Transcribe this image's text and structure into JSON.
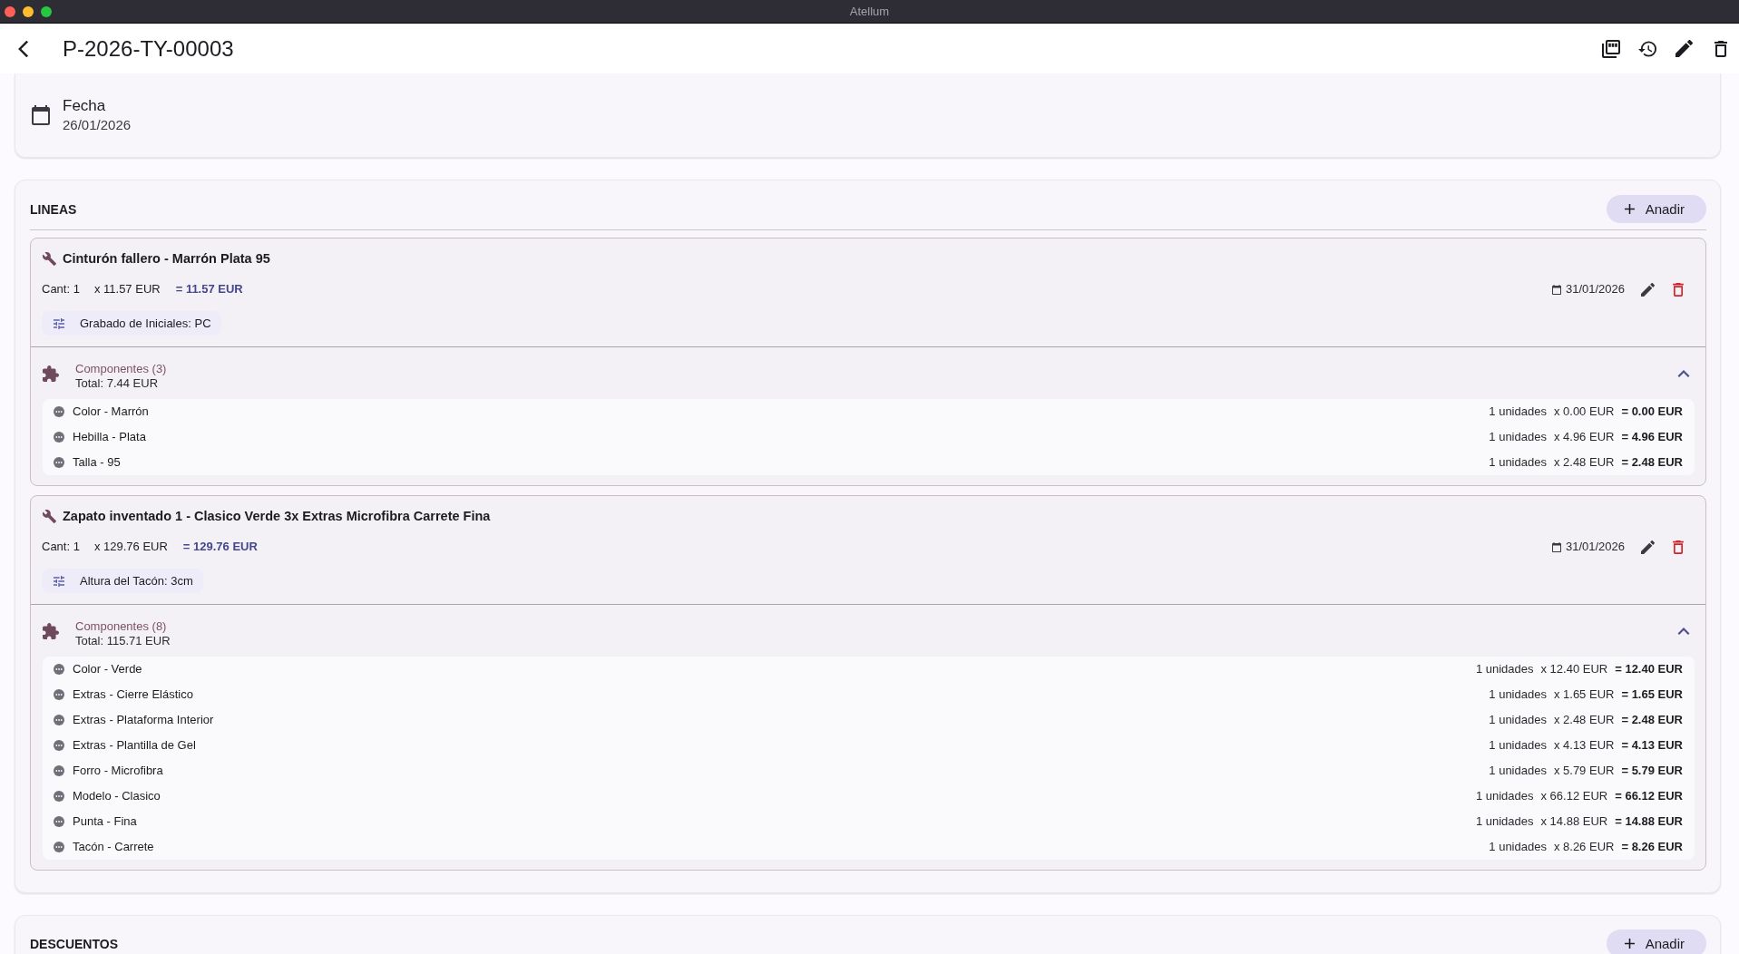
{
  "window": {
    "title": "Atellum"
  },
  "app_bar": {
    "title": "P-2026-TY-00003"
  },
  "date_field": {
    "label": "Fecha",
    "value": "26/01/2026"
  },
  "lines_section": {
    "title": "LINEAS",
    "add_button": "Anadir",
    "lines": [
      {
        "name": "Cinturón fallero - Marrón Plata 95",
        "quantity": "Cant: 1",
        "unit_price": "x 11.57 EUR",
        "total": "= 11.57 EUR",
        "date": "31/01/2026",
        "options": [
          "Grabado de Iniciales: PC"
        ],
        "components": {
          "title": "Componentes (3)",
          "total": "Total: 7.44 EUR",
          "expanded": true,
          "items": [
            {
              "name": "Color - Marrón",
              "quantity": "1 unidades",
              "unit_price": "x 0.00 EUR",
              "total": "= 0.00 EUR"
            },
            {
              "name": "Hebilla - Plata",
              "quantity": "1 unidades",
              "unit_price": "x 4.96 EUR",
              "total": "= 4.96 EUR"
            },
            {
              "name": "Talla - 95",
              "quantity": "1 unidades",
              "unit_price": "x 2.48 EUR",
              "total": "= 2.48 EUR"
            }
          ]
        }
      },
      {
        "name": "Zapato inventado 1 - Clasico Verde 3x Extras Microfibra Carrete Fina",
        "quantity": "Cant: 1",
        "unit_price": "x 129.76 EUR",
        "total": "= 129.76 EUR",
        "date": "31/01/2026",
        "options": [
          "Altura del Tacón: 3cm"
        ],
        "components": {
          "title": "Componentes (8)",
          "total": "Total: 115.71 EUR",
          "expanded": true,
          "items": [
            {
              "name": "Color - Verde",
              "quantity": "1 unidades",
              "unit_price": "x 12.40 EUR",
              "total": "= 12.40 EUR"
            },
            {
              "name": "Extras - Cierre Elástico",
              "quantity": "1 unidades",
              "unit_price": "x 1.65 EUR",
              "total": "= 1.65 EUR"
            },
            {
              "name": "Extras - Plataforma Interior",
              "quantity": "1 unidades",
              "unit_price": "x 2.48 EUR",
              "total": "= 2.48 EUR"
            },
            {
              "name": "Extras - Plantilla de Gel",
              "quantity": "1 unidades",
              "unit_price": "x 4.13 EUR",
              "total": "= 4.13 EUR"
            },
            {
              "name": "Forro - Microfibra",
              "quantity": "1 unidades",
              "unit_price": "x 5.79 EUR",
              "total": "= 5.79 EUR"
            },
            {
              "name": "Modelo - Clasico",
              "quantity": "1 unidades",
              "unit_price": "x 66.12 EUR",
              "total": "= 66.12 EUR"
            },
            {
              "name": "Punta - Fina",
              "quantity": "1 unidades",
              "unit_price": "x 14.88 EUR",
              "total": "= 14.88 EUR"
            },
            {
              "name": "Tacón - Carrete",
              "quantity": "1 unidades",
              "unit_price": "x 8.26 EUR",
              "total": "= 8.26 EUR"
            }
          ]
        }
      }
    ]
  },
  "discounts_section": {
    "title": "DESCUENTOS",
    "add_button": "Anadir"
  }
}
